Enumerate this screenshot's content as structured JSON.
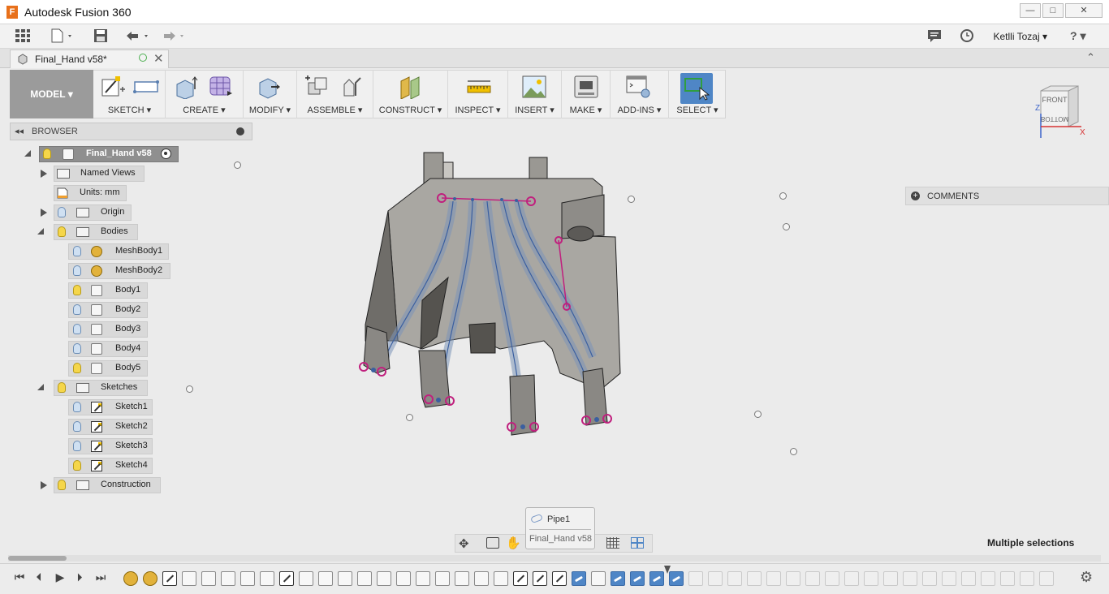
{
  "window": {
    "title": "Autodesk Fusion 360",
    "app_icon": "F"
  },
  "window_controls": {
    "minimize": "—",
    "maximize": "□",
    "close": "✕"
  },
  "quickbar": {
    "user": "Ketlli Tozaj ▾",
    "help": "? ▾"
  },
  "doc_tab": {
    "title": "Final_Hand v58*"
  },
  "ribbon": {
    "workspace": "MODEL ▾",
    "groups": [
      {
        "label": "SKETCH ▾"
      },
      {
        "label": "CREATE ▾"
      },
      {
        "label": "MODIFY ▾"
      },
      {
        "label": "ASSEMBLE ▾"
      },
      {
        "label": "CONSTRUCT ▾"
      },
      {
        "label": "INSPECT ▾"
      },
      {
        "label": "INSERT ▾"
      },
      {
        "label": "MAKE ▾"
      },
      {
        "label": "ADD-INS ▾"
      },
      {
        "label": "SELECT ▾"
      }
    ]
  },
  "browser": {
    "header": "BROWSER",
    "root": "Final_Hand v58",
    "nodes": {
      "named_views": "Named Views",
      "units": "Units: mm",
      "origin": "Origin",
      "bodies": "Bodies",
      "meshbody1": "MeshBody1",
      "meshbody2": "MeshBody2",
      "body1": "Body1",
      "body2": "Body2",
      "body3": "Body3",
      "body4": "Body4",
      "body5": "Body5",
      "sketches": "Sketches",
      "sketch1": "Sketch1",
      "sketch2": "Sketch2",
      "sketch3": "Sketch3",
      "sketch4": "Sketch4",
      "construction": "Construction"
    }
  },
  "comments": {
    "label": "COMMENTS"
  },
  "viewcube": {
    "face_top": "FRONT",
    "face_bottom": "BOTTOM",
    "axis_x": "X",
    "axis_z": "Z"
  },
  "tooltip": {
    "line1": "Pipe1",
    "line2": "Final_Hand v58"
  },
  "status": {
    "text": "Multiple selections"
  },
  "timeline": {
    "items": [
      "mesh",
      "mesh",
      "sketch",
      "extrude",
      "extrude",
      "extrude",
      "extrude",
      "extrude",
      "sketch",
      "extrude",
      "extrude",
      "fillet",
      "fillet",
      "fillet",
      "fillet",
      "fillet",
      "fillet",
      "fillet",
      "fillet",
      "fillet",
      "sketch",
      "sketch",
      "sketch",
      "pipe-selected",
      "fillet",
      "pipe-selected",
      "pipe-selected",
      "pipe-selected",
      "pipe-selected",
      "dim",
      "dim",
      "dim",
      "dim",
      "dim",
      "dim",
      "dim",
      "dim",
      "dim",
      "dim",
      "dim",
      "dim",
      "dim",
      "dim",
      "dim",
      "dim",
      "dim",
      "dim",
      "dim",
      "dim",
      "dim"
    ]
  },
  "colors": {
    "accent": "#4f86c6",
    "selection": "#c0207e",
    "model": "#8e8c88"
  }
}
